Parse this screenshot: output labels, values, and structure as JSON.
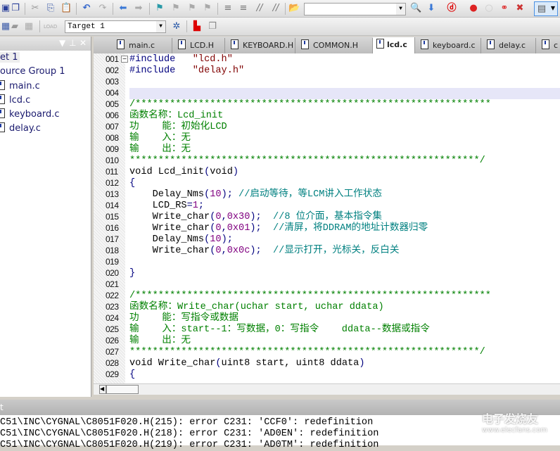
{
  "toolbar": {
    "target": "Target 1",
    "search_value": "",
    "icons": [
      "save-icon",
      "save-all-icon",
      "cut-icon",
      "copy-icon",
      "paste-icon",
      "undo-icon",
      "redo-icon",
      "back-icon",
      "forward-icon",
      "bookmark-icon",
      "prev-bookmark-icon",
      "next-bookmark-icon",
      "clear-bookmark-icon",
      "indent-icon",
      "unindent-icon",
      "comment-icon",
      "uncomment-icon",
      "find-in-files-icon"
    ]
  },
  "project": {
    "root": "et 1",
    "group": "ource Group 1",
    "files": [
      "main.c",
      "lcd.c",
      "keyboard.c",
      "delay.c"
    ]
  },
  "tabs": [
    "main.c",
    "LCD.H",
    "KEYBOARD.H",
    "COMMON.H",
    "lcd.c",
    "keyboard.c",
    "delay.c",
    "c"
  ],
  "active_tab": "lcd.c",
  "code": [
    {
      "n": "001",
      "s": [
        [
          "o",
          "#include"
        ],
        [
          "p",
          "   "
        ],
        [
          "s",
          "\"lcd.h\""
        ]
      ]
    },
    {
      "n": "002",
      "s": [
        [
          "o",
          "#include"
        ],
        [
          "p",
          "   "
        ],
        [
          "s",
          "\"delay.h\""
        ]
      ]
    },
    {
      "n": "003",
      "s": []
    },
    {
      "n": "004",
      "s": []
    },
    {
      "n": "005",
      "s": [
        [
          "c",
          "/**************************************************************"
        ]
      ]
    },
    {
      "n": "006",
      "s": [
        [
          "c",
          "函数名称：Lcd_init"
        ]
      ]
    },
    {
      "n": "007",
      "s": [
        [
          "c",
          "功    能：初始化LCD"
        ]
      ]
    },
    {
      "n": "008",
      "s": [
        [
          "c",
          "输    入：无"
        ]
      ]
    },
    {
      "n": "009",
      "s": [
        [
          "c",
          "输    出：无"
        ]
      ]
    },
    {
      "n": "010",
      "s": [
        [
          "c",
          "*************************************************************/"
        ]
      ]
    },
    {
      "n": "011",
      "s": [
        [
          "p",
          "void Lcd_init"
        ],
        [
          "o",
          "("
        ],
        [
          "p",
          "void"
        ],
        [
          "o",
          ")"
        ]
      ]
    },
    {
      "n": "012",
      "s": [
        [
          "o",
          "{"
        ]
      ]
    },
    {
      "n": "013",
      "s": [
        [
          "p",
          "    Delay_Nms"
        ],
        [
          "o",
          "("
        ],
        [
          "n",
          "10"
        ],
        [
          "o",
          ");"
        ],
        [
          "t",
          " //启动等待，等LCM讲入工作状态"
        ]
      ]
    },
    {
      "n": "014",
      "s": [
        [
          "p",
          "    LCD_RS"
        ],
        [
          "o",
          "="
        ],
        [
          "n",
          "1"
        ],
        [
          "o",
          ";"
        ]
      ]
    },
    {
      "n": "015",
      "s": [
        [
          "p",
          "    Write_char"
        ],
        [
          "o",
          "("
        ],
        [
          "n",
          "0"
        ],
        [
          "o",
          ","
        ],
        [
          "n",
          "0x30"
        ],
        [
          "o",
          ");"
        ],
        [
          "t",
          "  //8 位介面，基本指令集"
        ]
      ]
    },
    {
      "n": "016",
      "s": [
        [
          "p",
          "    Write_char"
        ],
        [
          "o",
          "("
        ],
        [
          "n",
          "0"
        ],
        [
          "o",
          ","
        ],
        [
          "n",
          "0x01"
        ],
        [
          "o",
          ");"
        ],
        [
          "t",
          "  //清屏，将DDRAM的地址计数器归零"
        ]
      ]
    },
    {
      "n": "017",
      "s": [
        [
          "p",
          "    Delay_Nms"
        ],
        [
          "o",
          "("
        ],
        [
          "n",
          "10"
        ],
        [
          "o",
          ");"
        ]
      ]
    },
    {
      "n": "018",
      "s": [
        [
          "p",
          "    Write_char"
        ],
        [
          "o",
          "("
        ],
        [
          "n",
          "0"
        ],
        [
          "o",
          ","
        ],
        [
          "n",
          "0x0c"
        ],
        [
          "o",
          ");"
        ],
        [
          "t",
          "  //显示打开，光标关，反白关"
        ]
      ]
    },
    {
      "n": "019",
      "s": []
    },
    {
      "n": "020",
      "s": [
        [
          "o",
          "}"
        ]
      ]
    },
    {
      "n": "021",
      "s": []
    },
    {
      "n": "022",
      "s": [
        [
          "c",
          "/**************************************************************"
        ]
      ]
    },
    {
      "n": "023",
      "s": [
        [
          "c",
          "函数名称：Write_char(uchar start, uchar ddata)"
        ]
      ]
    },
    {
      "n": "024",
      "s": [
        [
          "c",
          "功    能：写指令或数据"
        ]
      ]
    },
    {
      "n": "025",
      "s": [
        [
          "c",
          "输    入：start--1：写数据，0：写指令    ddata--数据或指令"
        ]
      ]
    },
    {
      "n": "026",
      "s": [
        [
          "c",
          "输    出：无"
        ]
      ]
    },
    {
      "n": "027",
      "s": [
        [
          "c",
          "*************************************************************/"
        ]
      ]
    },
    {
      "n": "028",
      "s": [
        [
          "p",
          "void Write_char"
        ],
        [
          "o",
          "("
        ],
        [
          "p",
          "uint8 start, uint8 ddata"
        ],
        [
          "o",
          ")"
        ]
      ]
    },
    {
      "n": "029",
      "s": [
        [
          "o",
          "{"
        ]
      ]
    }
  ],
  "output": {
    "title": "t",
    "lines": [
      "C51\\INC\\CYGNAL\\C8051F020.H(215): error C231: 'CCF0': redefinition",
      "C51\\INC\\CYGNAL\\C8051F020.H(218): error C231: 'AD0EN': redefinition",
      "C51\\INC\\CYGNAL\\C8051F020.H(219): error C231: 'AD0TM': redefinition"
    ]
  },
  "watermark": {
    "title": "电子发烧友",
    "url": "www.elecfans.com"
  }
}
